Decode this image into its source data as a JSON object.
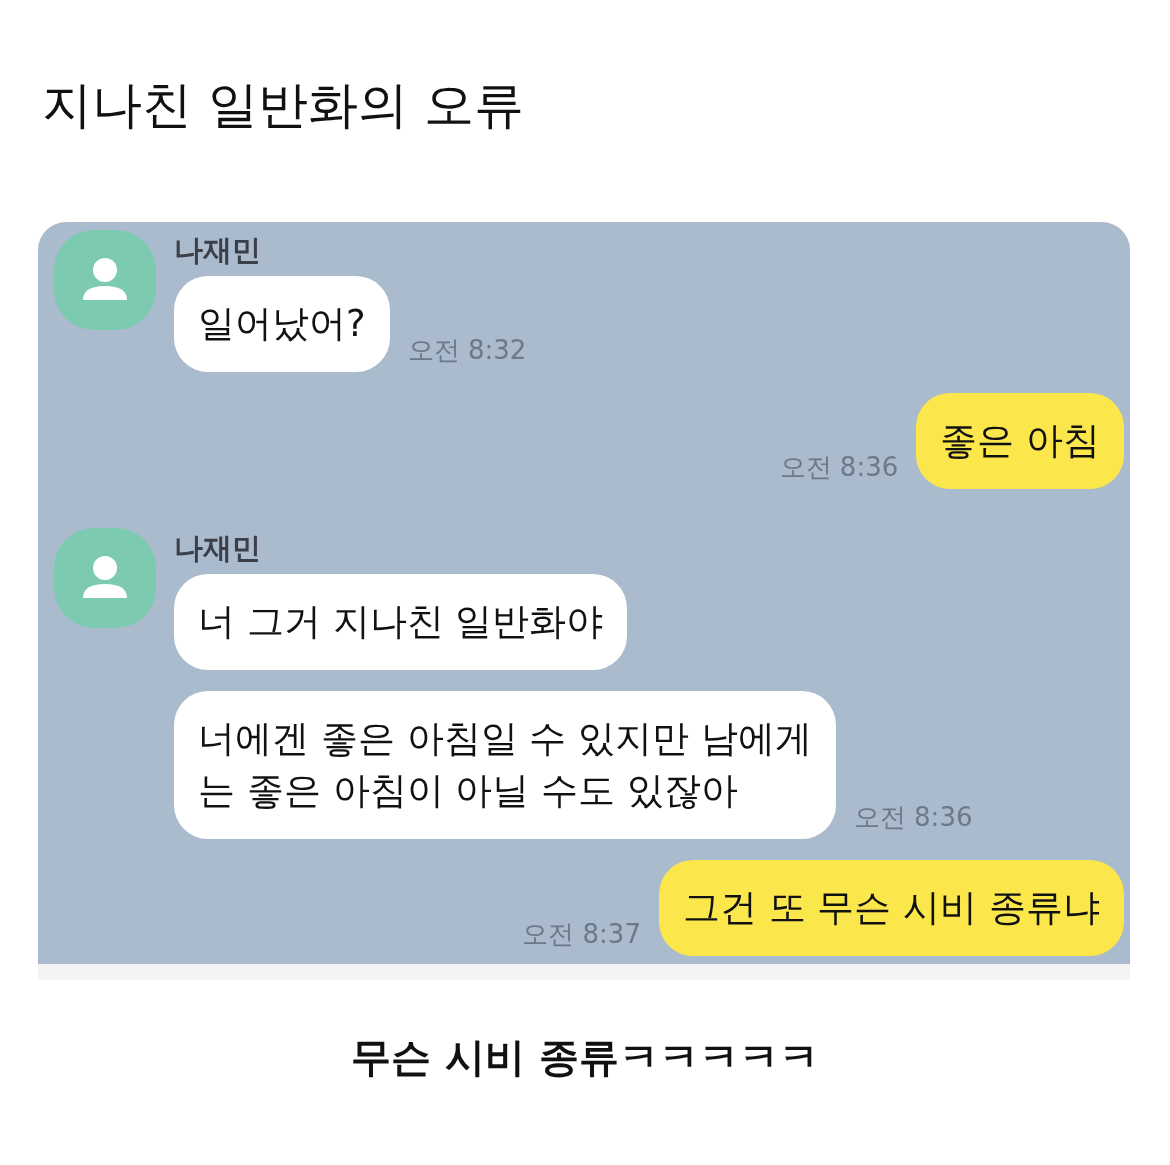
{
  "title": "지나친 일반화의 오류",
  "messages": [
    {
      "kind": "incoming",
      "sender": "나재민",
      "text": "일어났어?",
      "time": "오전 8:32"
    },
    {
      "kind": "outgoing",
      "text": "좋은 아침",
      "time": "오전 8:36"
    },
    {
      "kind": "incoming",
      "sender": "나재민",
      "text": "너 그거 지나친 일반화야"
    },
    {
      "kind": "incoming",
      "text": "너에겐 좋은 아침일 수 있지만 남에게\n는 좋은 아침이 아닐 수도 있잖아",
      "time": "오전 8:36"
    },
    {
      "kind": "outgoing",
      "text": "그건 또 무슨 시비 종류냐",
      "time": "오전 8:37"
    }
  ],
  "caption": "무슨 시비 종류ㅋㅋㅋㅋㅋ"
}
